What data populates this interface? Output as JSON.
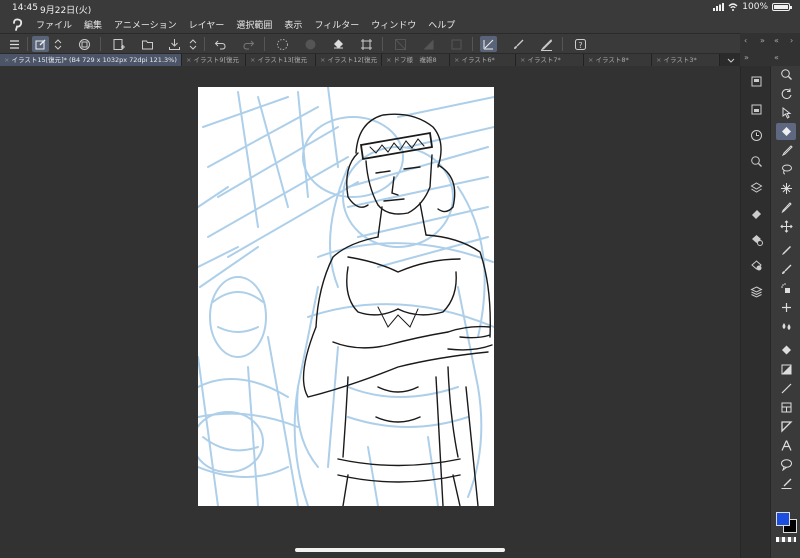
{
  "status_bar": {
    "time": "14:45",
    "date": "9月22日(火)",
    "battery": "100%",
    "battery_level": 1.0
  },
  "menu": {
    "items": [
      "ファイル",
      "編集",
      "アニメーション",
      "レイヤー",
      "選択範囲",
      "表示",
      "フィルター",
      "ウィンドウ",
      "ヘルプ"
    ]
  },
  "tabs": [
    {
      "label": "イラスト15[復元]* (B4 729 x 1032px 72dpi 121.3%)",
      "active": true
    },
    {
      "label": "イラスト9[復元"
    },
    {
      "label": "イラスト13[復元"
    },
    {
      "label": "イラスト12[復元"
    },
    {
      "label": "ドフ様　複雑8"
    },
    {
      "label": "イラスト6*"
    },
    {
      "label": "イラスト7*"
    },
    {
      "label": "イラスト8*"
    },
    {
      "label": "イラスト3*"
    }
  ],
  "colors": {
    "main_color": "#1c4fe0",
    "sub_color": "#000000",
    "accent": "#5e6880",
    "sketch_blue": "#a9cde8"
  },
  "toolbar_icons": [
    "menu-icon",
    "layer-select-icon",
    "up-down-icon",
    "canvas-icon",
    "new-canvas-icon",
    "open-icon",
    "save-icon",
    "up-down-icon",
    "undo-icon",
    "redo-icon",
    "loading-icon",
    "circle-icon",
    "fill-icon",
    "transform-icon",
    "no-select-icon",
    "half-icon",
    "square-icon",
    "ruler-edit-icon",
    "brush-icon",
    "pen-icon",
    "help-icon"
  ],
  "sub_palette_icons": [
    "layer-properties-icon",
    "navigator-icon",
    "history-icon",
    "search-icon",
    "layers-icon",
    "eraser-layer-icon",
    "delete-layer-icon",
    "layer-mask-icon",
    "stack-icon"
  ],
  "tool_palette_icons": [
    "zoom-icon",
    "rotate-icon",
    "object-icon",
    "select-icon",
    "pen-tool-icon",
    "lasso-icon",
    "sparkle-icon",
    "eyedropper-icon",
    "move-icon",
    "pencil-icon",
    "brush-tool-icon",
    "airbrush-icon",
    "blend-icon",
    "water-icon",
    "fill-tool-icon",
    "gradient-icon",
    "line-icon",
    "frame-icon",
    "ruler-icon",
    "text-icon",
    "balloon-icon",
    "correction-icon"
  ]
}
